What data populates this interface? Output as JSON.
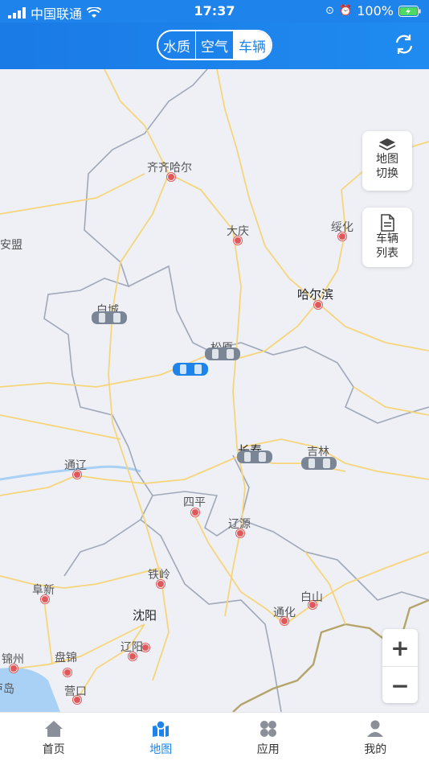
{
  "status": {
    "carrier": "中国联通",
    "time": "17:37",
    "battery": "100%"
  },
  "header": {
    "segments": [
      "水质",
      "空气",
      "车辆"
    ],
    "active_segment": "车辆"
  },
  "map": {
    "cities": [
      {
        "name": "齐齐哈尔",
        "big": false
      },
      {
        "name": "大庆",
        "big": false
      },
      {
        "name": "绥化",
        "big": false
      },
      {
        "name": "哈尔滨",
        "big": true
      },
      {
        "name": "白城",
        "big": false
      },
      {
        "name": "松原",
        "big": false
      },
      {
        "name": "长春",
        "big": true
      },
      {
        "name": "吉林",
        "big": false
      },
      {
        "name": "通辽",
        "big": false
      },
      {
        "name": "四平",
        "big": false
      },
      {
        "name": "辽源",
        "big": false
      },
      {
        "name": "铁岭",
        "big": false
      },
      {
        "name": "沈阳",
        "big": true
      },
      {
        "name": "阜新",
        "big": false
      },
      {
        "name": "白山",
        "big": false
      },
      {
        "name": "通化",
        "big": false
      },
      {
        "name": "辽阳",
        "big": false
      },
      {
        "name": "锦州",
        "big": false
      },
      {
        "name": "盘锦",
        "big": false
      },
      {
        "name": "营口",
        "big": false
      },
      {
        "name": "兴安盟",
        "big": false
      },
      {
        "name": "芦岛",
        "big": false
      }
    ],
    "controls": {
      "layer_switch": [
        "地图",
        "切换"
      ],
      "vehicle_list": [
        "车辆",
        "列表"
      ]
    },
    "zoom_in": "+",
    "zoom_out": "−"
  },
  "tabs": [
    {
      "label": "首页",
      "icon": "home-icon",
      "active": false
    },
    {
      "label": "地图",
      "icon": "map-icon",
      "active": true
    },
    {
      "label": "应用",
      "icon": "apps-icon",
      "active": false
    },
    {
      "label": "我的",
      "icon": "profile-icon",
      "active": false
    }
  ],
  "colors": {
    "brand": "#1e84ec",
    "road": "#f6d57a",
    "border": "#a0a8b8",
    "water": "#a9d1f5",
    "city_dot": "#e0585a",
    "vehicle_active": "#1e84ec",
    "vehicle_inactive": "#7a8596"
  }
}
